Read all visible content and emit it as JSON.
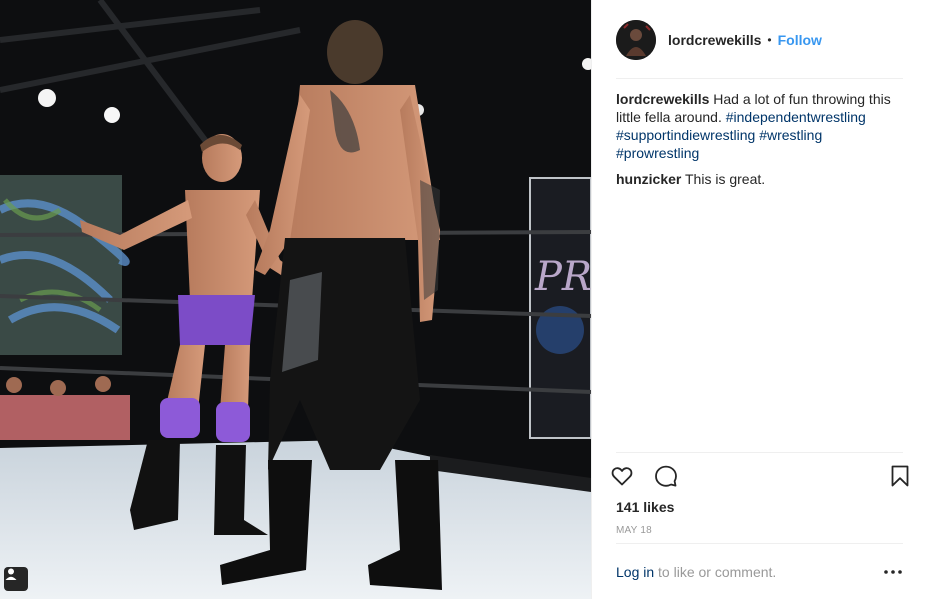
{
  "post": {
    "photo": {
      "alt": ""
    },
    "author": {
      "username": "lordcrewekills",
      "follow_label": "Follow",
      "separator": "•"
    },
    "comments": [
      {
        "username": "lordcrewekills",
        "text": "Had a lot of fun throwing this little fella around.",
        "hashtags": [
          "#independentwrestling",
          "#supportindiewrestling",
          "#wrestling",
          "#prowrestling"
        ]
      },
      {
        "username": "hunzicker",
        "text": "This is great.",
        "hashtags": []
      }
    ],
    "likes_label": "141 likes",
    "date_label": "MAY 18",
    "login_link": "Log in",
    "login_suffix": " to like or comment.",
    "icons": {
      "like": "heart-icon",
      "comment": "comment-icon",
      "save": "bookmark-icon",
      "more": "more-options-icon",
      "tag": "user-tag-icon"
    },
    "colors": {
      "link_blue": "#3897f0",
      "hashtag_navy": "#003569",
      "muted_gray": "#999999",
      "text": "#262626"
    }
  }
}
